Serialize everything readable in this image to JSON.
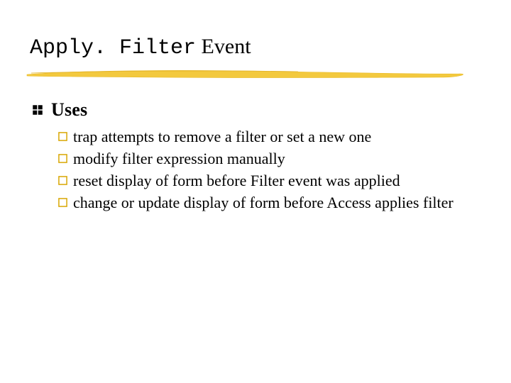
{
  "title": {
    "mono": "Apply. Filter",
    "rest": " Event"
  },
  "section": {
    "heading": "Uses",
    "items": [
      "trap attempts to remove a filter or set a new one",
      "modify filter expression manually",
      "reset display of form before Filter event was applied",
      "change or update display of form before Access applies filter"
    ]
  },
  "colors": {
    "highlight": "#f3c93e",
    "boxOutline": "#d8a600"
  }
}
